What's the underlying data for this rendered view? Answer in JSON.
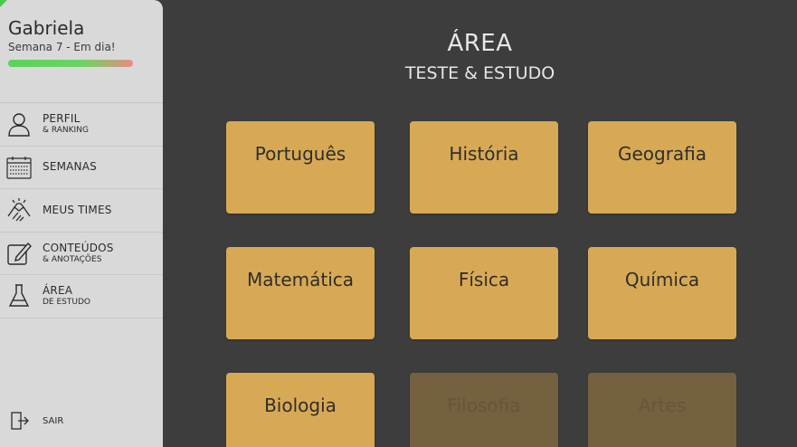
{
  "user": {
    "name": "Gabriela",
    "status": "Semana 7 - Em dia!"
  },
  "nav": {
    "items": [
      {
        "title": "PERFIL",
        "sub": "& RANKING",
        "icon": "user-icon"
      },
      {
        "title": "SEMANAS",
        "sub": "",
        "icon": "calendar-icon"
      },
      {
        "title": "MEUS TIMES",
        "sub": "",
        "icon": "handshake-icon"
      },
      {
        "title": "CONTEÚDOS",
        "sub": "& ANOTAÇÕES",
        "icon": "edit-icon"
      },
      {
        "title": "ÁREA",
        "sub": "DE ESTUDO",
        "icon": "flask-icon"
      }
    ],
    "logout": "SAIR"
  },
  "header": {
    "title": "ÁREA",
    "subtitle": "TESTE & ESTUDO"
  },
  "subjects": [
    {
      "label": "Português",
      "enabled": true
    },
    {
      "label": "História",
      "enabled": true
    },
    {
      "label": "Geografia",
      "enabled": true
    },
    {
      "label": "Matemática",
      "enabled": true
    },
    {
      "label": "Física",
      "enabled": true
    },
    {
      "label": "Química",
      "enabled": true
    },
    {
      "label": "Biologia",
      "enabled": true
    },
    {
      "label": "Filosofia",
      "enabled": false
    },
    {
      "label": "Artes",
      "enabled": false
    }
  ],
  "colors": {
    "background": "#3d3d3d",
    "sidebar": "#d9d9d9",
    "card": "#d8a955",
    "card_disabled": "#756040"
  }
}
